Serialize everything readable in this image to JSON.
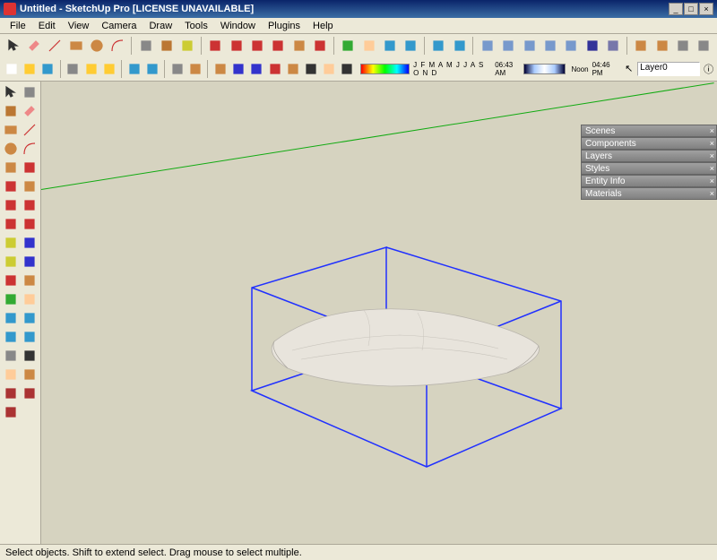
{
  "title": "Untitled - SketchUp Pro  [LICENSE UNAVAILABLE]",
  "menus": [
    "File",
    "Edit",
    "View",
    "Camera",
    "Draw",
    "Tools",
    "Window",
    "Plugins",
    "Help"
  ],
  "toolbar_top": [
    "select",
    "eraser",
    "line",
    "rect",
    "circle",
    "arc",
    "sep",
    "make-component",
    "paint",
    "tape",
    "sep",
    "move",
    "rotate",
    "offset",
    "scale",
    "pushpull",
    "freehand",
    "sep",
    "orbit",
    "pan",
    "zoom",
    "zoom-extents",
    "sep",
    "previous",
    "next",
    "sep",
    "iso",
    "top",
    "front",
    "right",
    "back",
    "shadows",
    "xray",
    "sep",
    "3dwarehouse",
    "upload",
    "layers",
    "outliner"
  ],
  "toolbar_second": [
    "new",
    "open",
    "save",
    "sep",
    "cut",
    "copy",
    "paste",
    "sep",
    "undo",
    "redo",
    "sep",
    "print",
    "model-info",
    "sep",
    "section",
    "dims",
    "text",
    "axes",
    "3dtext",
    "walk",
    "lookaround",
    "position-camera"
  ],
  "months": "J F M A M J J A S O N D",
  "time1": "06:43 AM",
  "time_mid": "Noon",
  "time2": "04:46 PM",
  "layer_label": "Layer0",
  "side_tools": [
    [
      "select",
      "component"
    ],
    [
      "paint",
      "eraser"
    ],
    [
      "rect",
      "line"
    ],
    [
      "circle",
      "arc"
    ],
    [
      "poly",
      "freehand"
    ],
    [
      "move",
      "pushpull"
    ],
    [
      "rotate",
      "followme"
    ],
    [
      "scale",
      "offset"
    ],
    [
      "tape",
      "dims"
    ],
    [
      "protractor",
      "text"
    ],
    [
      "axes",
      "3dtext"
    ],
    [
      "orbit",
      "pan"
    ],
    [
      "zoom",
      "zoom-window"
    ],
    [
      "previous",
      "zoom-extents"
    ],
    [
      "position",
      "walk"
    ],
    [
      "lookaround",
      "section"
    ],
    [
      "plugin1",
      "plugin2"
    ],
    [
      "plugin3",
      ""
    ]
  ],
  "panels": [
    "Scenes",
    "Components",
    "Layers",
    "Styles",
    "Entity Info",
    "Materials"
  ],
  "status": "Select objects. Shift to extend select. Drag mouse to select multiple.",
  "colors": {
    "select_blue": "#2030ff",
    "mesh": "#e8e4dc"
  }
}
